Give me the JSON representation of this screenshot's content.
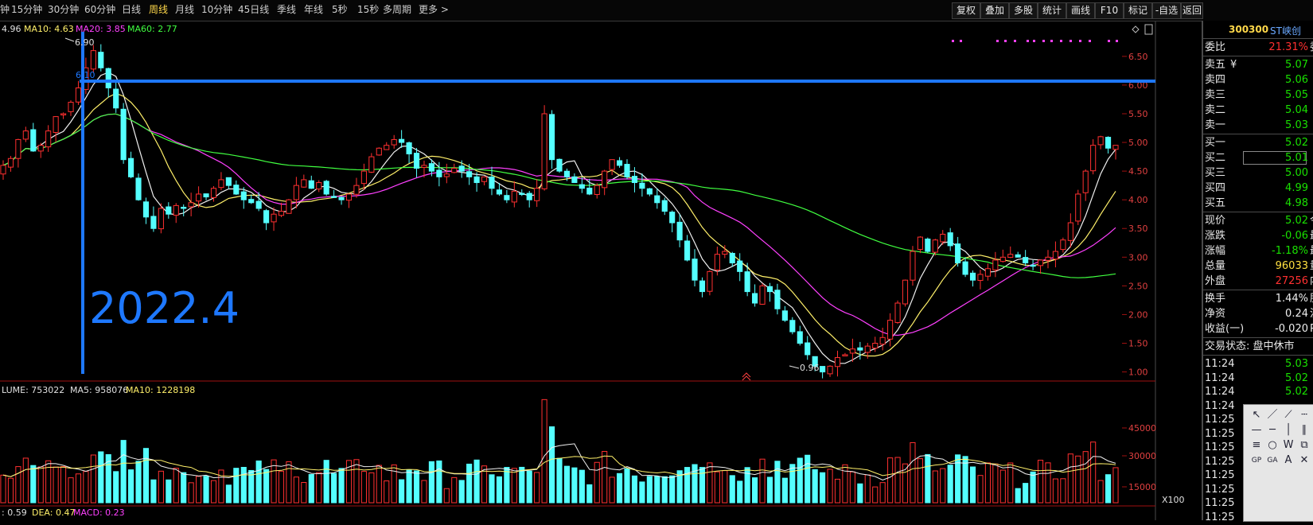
{
  "toolbar": {
    "left_tabs": [
      "钟",
      "15分钟",
      "30分钟",
      "60分钟",
      "日线",
      "周线",
      "月线",
      "10分钟",
      "45日线",
      "季线",
      "年线",
      "5秒",
      "15秒",
      "多周期",
      "更多 >"
    ],
    "active_tab": "周线",
    "right_buttons": [
      "复权",
      "叠加",
      "多股",
      "统计",
      "画线",
      "F10",
      "标记",
      "-自选",
      "返回"
    ]
  },
  "price_legend": {
    "prefix": "4.96",
    "ma10": "MA10: 4.63",
    "ma20": "MA20: 3.85",
    "ma60": "MA60: 2.77"
  },
  "volume_legend": {
    "prefix": "LUME: 753022",
    "ma5": "MA5: 958076",
    "ma10": "MA10: 1228198"
  },
  "macd_legend": {
    "dif": ": 0.59",
    "dea": "DEA: 0.47",
    "macd": "MACD: 0.23"
  },
  "annotations": {
    "high_label": "6.90",
    "hline_label": "6.10",
    "low_label": "0.96",
    "big_label": "2022.4",
    "vol_unit": "X100"
  },
  "price_axis": [
    "6.50",
    "6.00",
    "5.50",
    "5.00",
    "4.50",
    "4.00",
    "3.50",
    "3.00",
    "2.50",
    "2.00",
    "1.50",
    "1.00"
  ],
  "volume_axis": [
    "45000",
    "30000",
    "15000"
  ],
  "quote": {
    "code": "300300",
    "name": "ST峡创",
    "wei_bi": {
      "label": "委比",
      "value": "21.31%",
      "tail": "委"
    },
    "asks": [
      {
        "label": "卖五",
        "mark": "¥",
        "value": "5.07"
      },
      {
        "label": "卖四",
        "value": "5.06"
      },
      {
        "label": "卖三",
        "value": "5.05"
      },
      {
        "label": "卖二",
        "value": "5.04"
      },
      {
        "label": "卖一",
        "value": "5.03"
      }
    ],
    "bids": [
      {
        "label": "买一",
        "value": "5.02"
      },
      {
        "label": "买二",
        "value": "5.01"
      },
      {
        "label": "买三",
        "value": "5.00"
      },
      {
        "label": "买四",
        "value": "4.99"
      },
      {
        "label": "买五",
        "value": "4.98"
      }
    ],
    "stats": [
      {
        "label": "现价",
        "value": "5.02",
        "color": "green",
        "tail": "今"
      },
      {
        "label": "涨跌",
        "value": "-0.06",
        "color": "green",
        "tail": "最"
      },
      {
        "label": "涨幅",
        "value": "-1.18%",
        "color": "green",
        "tail": "最"
      },
      {
        "label": "总量",
        "value": "96033",
        "color": "yellow",
        "tail": "量"
      },
      {
        "label": "外盘",
        "value": "27256",
        "color": "red",
        "tail": "内"
      }
    ],
    "stats2": [
      {
        "label": "换手",
        "value": "1.44%",
        "tail": "股"
      },
      {
        "label": "净资",
        "value": "0.24",
        "tail": "流"
      },
      {
        "label": "收益(一)",
        "value": "-0.020",
        "tail": "P"
      }
    ],
    "trade_status": "交易状态: 盘中休市",
    "ticks": [
      {
        "time": "11:24",
        "price": "5.03"
      },
      {
        "time": "11:24",
        "price": "5.02"
      },
      {
        "time": "11:24",
        "price": "5.02"
      },
      {
        "time": "11:24",
        "price": ""
      },
      {
        "time": "11:25",
        "price": ""
      },
      {
        "time": "11:25",
        "price": ""
      },
      {
        "time": "11:25",
        "price": ""
      },
      {
        "time": "11:25",
        "price": ""
      },
      {
        "time": "11:25",
        "price": ""
      },
      {
        "time": "11:25",
        "price": ""
      },
      {
        "time": "11:25",
        "price": ""
      },
      {
        "time": "11:25",
        "price": ""
      }
    ]
  },
  "drawing_tools": [
    "select-arrow-icon",
    "line-icon",
    "ray-icon",
    "dashed-line-icon",
    "segment-icon",
    "horizontal-line-icon",
    "vertical-line-icon",
    "parallel-icon",
    "fibonacci-icon",
    "circle-icon",
    "wave-icon",
    "channel-icon",
    "gap-icon",
    "gann-icon",
    "text-icon",
    "delete-icon"
  ],
  "chart_data": {
    "type": "candlestick",
    "y_range": [
      0.8,
      6.9
    ],
    "ma_labels": [
      "MA5",
      "MA10",
      "MA20",
      "MA60"
    ],
    "closes": [
      4.6,
      4.72,
      5.05,
      5.2,
      4.85,
      4.95,
      5.2,
      5.45,
      5.5,
      5.7,
      5.95,
      6.3,
      6.6,
      6.3,
      5.95,
      5.6,
      4.7,
      4.4,
      4.0,
      3.7,
      3.5,
      3.85,
      3.75,
      3.9,
      3.85,
      3.95,
      4.1,
      4.05,
      4.2,
      4.35,
      4.25,
      4.1,
      4.0,
      3.95,
      3.85,
      3.6,
      3.75,
      3.8,
      4.0,
      4.25,
      4.35,
      4.2,
      4.3,
      4.1,
      4.05,
      4.0,
      4.1,
      4.25,
      4.5,
      4.75,
      4.9,
      4.95,
      5.05,
      5.0,
      4.8,
      4.55,
      4.6,
      4.5,
      4.4,
      4.45,
      4.55,
      4.5,
      4.4,
      4.3,
      4.4,
      4.2,
      4.1,
      4.0,
      4.15,
      4.1,
      4.0,
      4.2,
      5.5,
      4.7,
      4.5,
      4.4,
      4.3,
      4.2,
      4.1,
      4.25,
      4.5,
      4.7,
      4.6,
      4.4,
      4.3,
      4.2,
      4.1,
      3.95,
      3.8,
      3.6,
      3.3,
      2.95,
      2.6,
      2.4,
      2.75,
      3.05,
      3.1,
      2.9,
      2.75,
      2.4,
      2.2,
      2.5,
      2.4,
      2.1,
      1.9,
      1.7,
      1.5,
      1.3,
      1.1,
      1.0,
      1.1,
      1.25,
      1.3,
      1.4,
      1.38,
      1.45,
      1.5,
      1.6,
      1.9,
      2.2,
      2.6,
      3.1,
      3.35,
      3.1,
      3.3,
      3.4,
      3.2,
      2.9,
      2.7,
      2.6,
      2.7,
      2.8,
      2.95,
      3.0,
      3.05,
      3.0,
      2.9,
      2.85,
      2.95,
      3.0,
      3.1,
      3.3,
      3.6,
      4.1,
      4.5,
      4.95,
      5.1,
      4.9,
      4.95
    ]
  }
}
